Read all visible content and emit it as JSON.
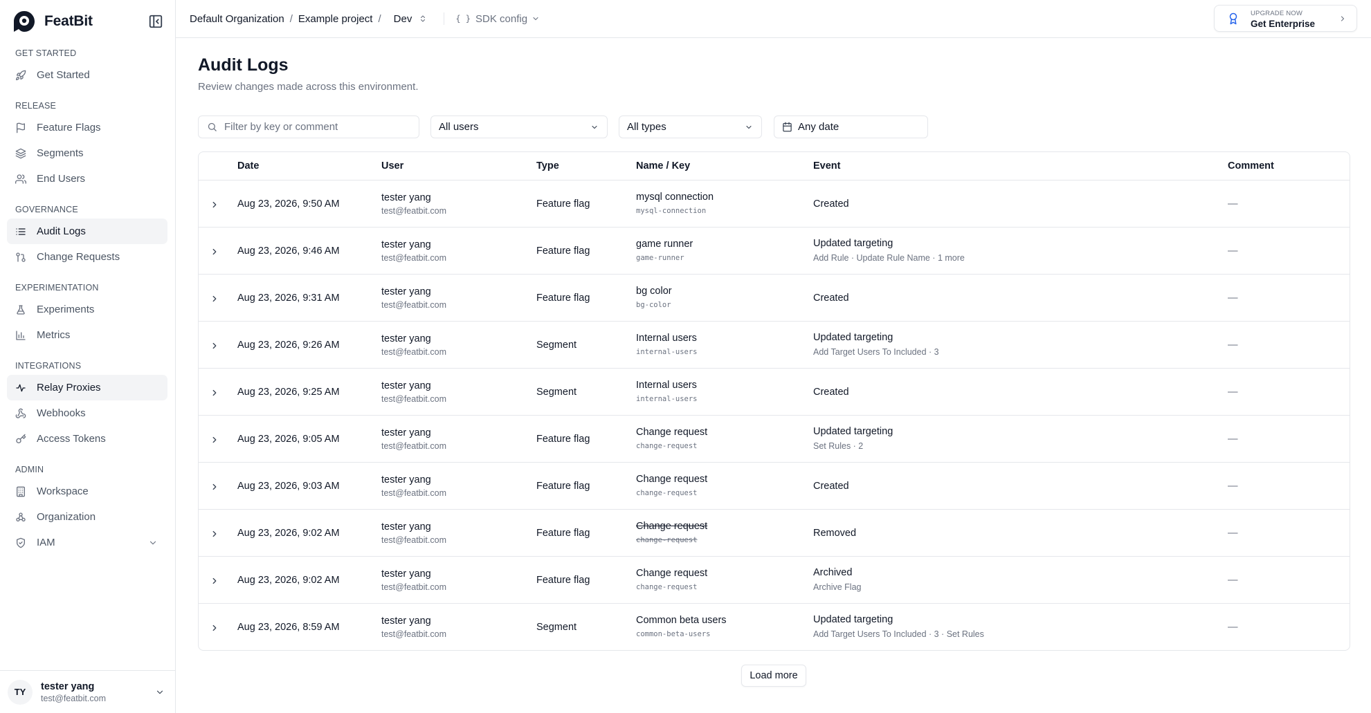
{
  "brand": {
    "name": "FeatBit"
  },
  "sidebar": {
    "sections": [
      {
        "title": "GET STARTED",
        "items": [
          {
            "label": "Get Started",
            "icon": "rocket-icon"
          }
        ]
      },
      {
        "title": "RELEASE",
        "items": [
          {
            "label": "Feature Flags",
            "icon": "flag-icon"
          },
          {
            "label": "Segments",
            "icon": "layers-icon"
          },
          {
            "label": "End Users",
            "icon": "users-icon"
          }
        ]
      },
      {
        "title": "GOVERNANCE",
        "items": [
          {
            "label": "Audit Logs",
            "icon": "list-icon",
            "active": true
          },
          {
            "label": "Change Requests",
            "icon": "git-pull-request-icon"
          }
        ]
      },
      {
        "title": "EXPERIMENTATION",
        "items": [
          {
            "label": "Experiments",
            "icon": "flask-icon"
          },
          {
            "label": "Metrics",
            "icon": "bar-chart-icon"
          }
        ]
      },
      {
        "title": "INTEGRATIONS",
        "items": [
          {
            "label": "Relay Proxies",
            "icon": "relay-icon",
            "active": true
          },
          {
            "label": "Webhooks",
            "icon": "webhook-icon"
          },
          {
            "label": "Access Tokens",
            "icon": "key-icon"
          }
        ]
      },
      {
        "title": "ADMIN",
        "items": [
          {
            "label": "Workspace",
            "icon": "building-icon"
          },
          {
            "label": "Organization",
            "icon": "organization-icon"
          },
          {
            "label": "IAM",
            "icon": "shield-icon"
          }
        ]
      }
    ],
    "user": {
      "initials": "TY",
      "name": "tester yang",
      "email": "test@featbit.com"
    }
  },
  "header": {
    "breadcrumb": {
      "organization": "Default Organization",
      "project": "Example project",
      "environment": "Dev",
      "separator": "/"
    },
    "sdk": {
      "braces": "{ }",
      "label": "SDK config"
    },
    "upgrade": {
      "small": "UPGRADE NOW",
      "big": "Get Enterprise"
    }
  },
  "main": {
    "title": "Audit Logs",
    "subtitle": "Review changes made across this environment.",
    "filters": {
      "search_placeholder": "Filter by key or comment",
      "users": "All users",
      "types": "All types",
      "date": "Any date"
    },
    "columns": {
      "date": "Date",
      "user": "User",
      "type": "Type",
      "name_key": "Name / Key",
      "event": "Event",
      "comment": "Comment"
    },
    "rows": [
      {
        "date": "Aug 23, 2026, 9:50 AM",
        "user": "tester yang",
        "email": "test@featbit.com",
        "type": "Feature flag",
        "name": "mysql connection",
        "key": "mysql-connection",
        "event": "Created",
        "detail": "",
        "comment": "—"
      },
      {
        "date": "Aug 23, 2026, 9:46 AM",
        "user": "tester yang",
        "email": "test@featbit.com",
        "type": "Feature flag",
        "name": "game runner",
        "key": "game-runner",
        "event": "Updated targeting",
        "detail": "Add Rule · Update Rule Name · 1 more",
        "comment": "—"
      },
      {
        "date": "Aug 23, 2026, 9:31 AM",
        "user": "tester yang",
        "email": "test@featbit.com",
        "type": "Feature flag",
        "name": "bg color",
        "key": "bg-color",
        "event": "Created",
        "detail": "",
        "comment": "—"
      },
      {
        "date": "Aug 23, 2026, 9:26 AM",
        "user": "tester yang",
        "email": "test@featbit.com",
        "type": "Segment",
        "name": "Internal users",
        "key": "internal-users",
        "event": "Updated targeting",
        "detail": "Add Target Users To Included · 3",
        "comment": "—"
      },
      {
        "date": "Aug 23, 2026, 9:25 AM",
        "user": "tester yang",
        "email": "test@featbit.com",
        "type": "Segment",
        "name": "Internal users",
        "key": "internal-users",
        "event": "Created",
        "detail": "",
        "comment": "—"
      },
      {
        "date": "Aug 23, 2026, 9:05 AM",
        "user": "tester yang",
        "email": "test@featbit.com",
        "type": "Feature flag",
        "name": "Change request",
        "key": "change-request",
        "event": "Updated targeting",
        "detail": "Set Rules · 2",
        "comment": "—"
      },
      {
        "date": "Aug 23, 2026, 9:03 AM",
        "user": "tester yang",
        "email": "test@featbit.com",
        "type": "Feature flag",
        "name": "Change request",
        "key": "change-request",
        "event": "Created",
        "detail": "",
        "comment": "—"
      },
      {
        "date": "Aug 23, 2026, 9:02 AM",
        "user": "tester yang",
        "email": "test@featbit.com",
        "type": "Feature flag",
        "name": "Change request",
        "key": "change-request",
        "event": "Removed",
        "detail": "",
        "comment": "—",
        "removed": true
      },
      {
        "date": "Aug 23, 2026, 9:02 AM",
        "user": "tester yang",
        "email": "test@featbit.com",
        "type": "Feature flag",
        "name": "Change request",
        "key": "change-request",
        "event": "Archived",
        "detail": "Archive Flag",
        "comment": "—"
      },
      {
        "date": "Aug 23, 2026, 8:59 AM",
        "user": "tester yang",
        "email": "test@featbit.com",
        "type": "Segment",
        "name": "Common beta users",
        "key": "common-beta-users",
        "event": "Updated targeting",
        "detail": "Add Target Users To Included · 3 · Set Rules",
        "comment": "—"
      }
    ],
    "load_more": "Load more"
  },
  "colors": {
    "accent": "#2563eb",
    "text": "#111827",
    "muted": "#6b7280",
    "border": "#e5e7eb",
    "active_bg": "#f3f4f6"
  }
}
